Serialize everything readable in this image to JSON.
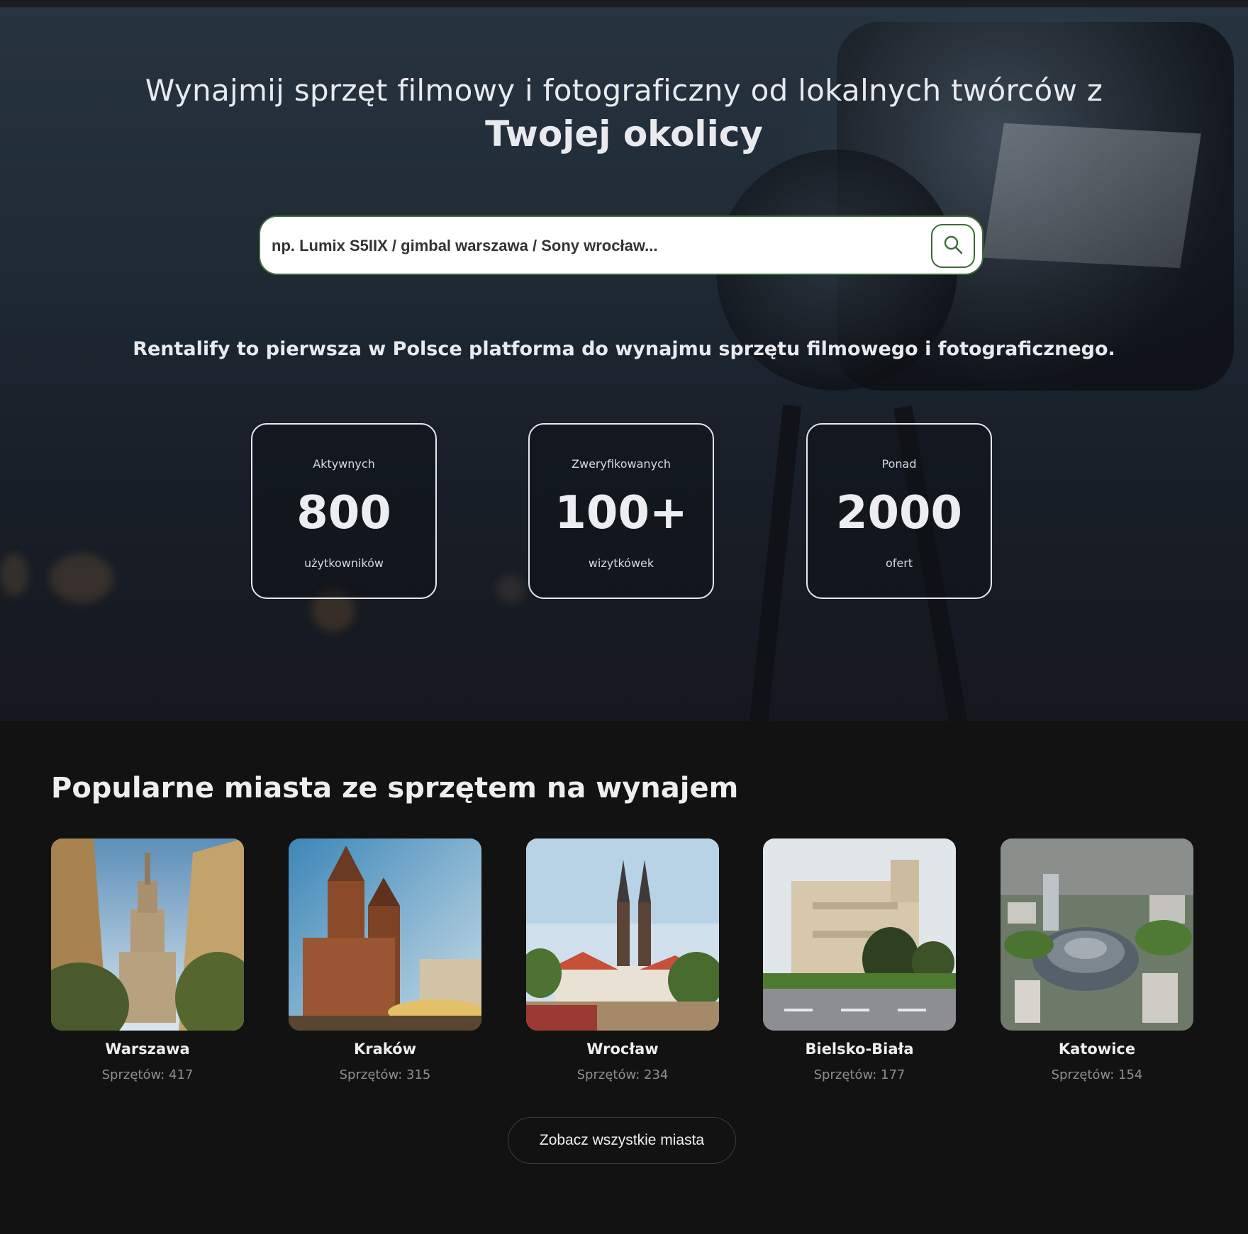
{
  "hero": {
    "title_line1": "Wynajmij sprzęt filmowy i fotograficzny od lokalnych twórców z",
    "title_line2": "Twojej okolicy",
    "search": {
      "placeholder": "np. Lumix S5IIX / gimbal warszawa / Sony wrocław...",
      "button_icon": "search-icon"
    },
    "tagline": "Rentalify to pierwsza w Polsce platforma do wynajmu sprzętu filmowego i fotograficznego.",
    "stats": [
      {
        "pre": "Aktywnych",
        "number": "800",
        "post": "użytkowników"
      },
      {
        "pre": "Zweryfikowanych",
        "number": "100+",
        "post": "wizytkówek"
      },
      {
        "pre": "Ponad",
        "number": "2000",
        "post": "ofert"
      }
    ]
  },
  "cities": {
    "heading": "Popularne miasta ze sprzętem na wynajem",
    "items": [
      {
        "name": "Warszawa",
        "count": "Sprzętów: 417"
      },
      {
        "name": "Kraków",
        "count": "Sprzętów: 315"
      },
      {
        "name": "Wrocław",
        "count": "Sprzętów: 234"
      },
      {
        "name": "Bielsko-Biała",
        "count": "Sprzętów: 177"
      },
      {
        "name": "Katowice",
        "count": "Sprzętów: 154"
      }
    ],
    "all_button": "Zobacz wszystkie miasta"
  },
  "colors": {
    "accent_green": "#3e6b3a",
    "background": "#121212",
    "muted_text": "#8d8f94"
  }
}
